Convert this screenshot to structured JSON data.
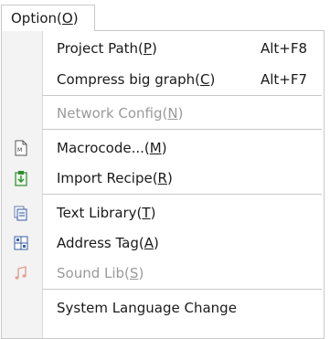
{
  "menubar": {
    "option_label": "Option(",
    "option_key": "O",
    "option_close": ")"
  },
  "menu": {
    "items": [
      {
        "name": "Project Path(",
        "key": "P",
        "close": ")",
        "shortcut": "Alt+F8"
      },
      {
        "name": "Compress big graph(",
        "key": "C",
        "close": ")",
        "shortcut": "Alt+F7"
      },
      {
        "name": "Network Config(",
        "key": "N",
        "close": ")",
        "disabled": true
      },
      {
        "name": "Macrocode...(",
        "key": "M",
        "close": ")",
        "icon": "macrocode-icon"
      },
      {
        "name": "Import Recipe(",
        "key": "R",
        "close": ")",
        "icon": "import-recipe-icon"
      },
      {
        "name": "Text Library(",
        "key": "T",
        "close": ")",
        "icon": "text-library-icon"
      },
      {
        "name": "Address Tag(",
        "key": "A",
        "close": ")",
        "icon": "address-tag-icon"
      },
      {
        "name": "Sound Lib(",
        "key": "S",
        "close": ")",
        "icon": "sound-lib-icon",
        "disabled": true
      },
      {
        "name": "System Language Change"
      }
    ]
  },
  "colors": {
    "text": "#1a1a1a",
    "disabled_text": "#9a9a9a",
    "gutter": "#f3f3f3",
    "separator": "#c8c8c8",
    "icon_green": "#2e8b2e",
    "icon_blue": "#3a5fa0",
    "icon_sound": "#e0a090"
  }
}
